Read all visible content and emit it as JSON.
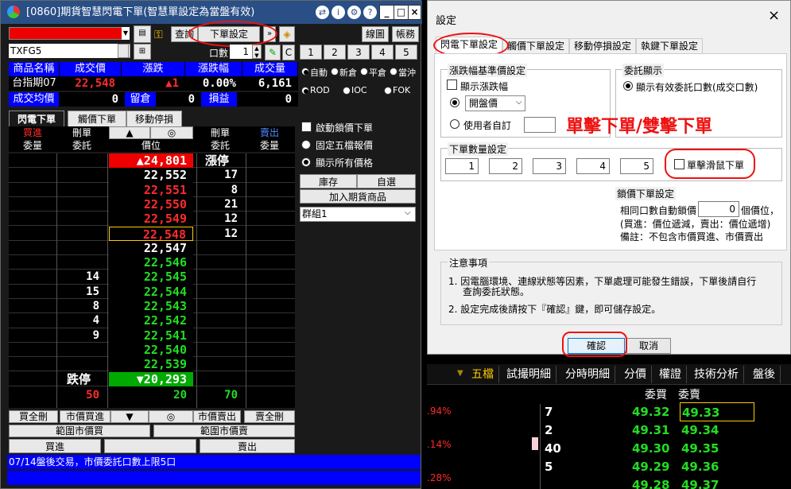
{
  "left": {
    "title": "[0860]期貨智慧閃電下單(智慧單設定為當盤有效)",
    "top_buttons": {
      "query": "查詢",
      "order_settings": "下單設定",
      "line_chart": "線圖",
      "account": "帳務"
    },
    "symbol": "TXFG5",
    "qty_label": "口數",
    "qty_value": "1",
    "c_btn": "C",
    "qty_presets": [
      "1",
      "2",
      "3",
      "4",
      "5"
    ],
    "info_headers": [
      "商品名稱",
      "成交價",
      "漲跌",
      "漲跌幅",
      "成交量"
    ],
    "info_values": {
      "name": "台指期07",
      "price": "22,548",
      "change": "▲1",
      "pct": "0.00%",
      "volume": "6,161"
    },
    "avg_label": "成交均價",
    "avg_value": "0",
    "remain_label": "留倉",
    "remain_value": "0",
    "pl_label": "損益",
    "pl_value": "0",
    "options_row1": [
      "自動",
      "新倉",
      "平倉",
      "當沖"
    ],
    "options_row2": [
      "ROD",
      "IOC",
      "FOK"
    ],
    "tabs": [
      "閃電下單",
      "觸價下單",
      "移動停損"
    ],
    "ladder_headers": {
      "buy_cancel": "刪單",
      "buy_order": "委託",
      "buy_entrust": "買進",
      "buy_qty": "委量",
      "price": "價位",
      "sell_cancel": "刪單",
      "sell_order": "委託",
      "sell_entrust": "賣出",
      "sell_qty": "委量",
      "up_arrow": "▲",
      "center": "◎"
    },
    "ladder": [
      {
        "price": "▲24,801",
        "type": "limitup",
        "sell": "漲停"
      },
      {
        "price": "22,552",
        "type": "white",
        "sell": "17"
      },
      {
        "price": "22,551",
        "type": "red",
        "sell": "8"
      },
      {
        "price": "22,550",
        "type": "red",
        "sell": "21"
      },
      {
        "price": "22,549",
        "type": "red",
        "sell": "12"
      },
      {
        "price": "22,548",
        "type": "current",
        "sell": "12"
      },
      {
        "price": "22,547",
        "type": "white",
        "buy": ""
      },
      {
        "price": "22,546",
        "type": "green",
        "buy": ""
      },
      {
        "price": "22,545",
        "type": "green",
        "buy": "14"
      },
      {
        "price": "22,544",
        "type": "green",
        "buy": "15"
      },
      {
        "price": "22,543",
        "type": "green",
        "buy": "8"
      },
      {
        "price": "22,542",
        "type": "green",
        "buy": "4"
      },
      {
        "price": "22,541",
        "type": "green",
        "buy": "9"
      },
      {
        "price": "22,540",
        "type": "green",
        "buy": ""
      },
      {
        "price": "22,539",
        "type": "green",
        "buy": ""
      },
      {
        "price": "▼20,293",
        "type": "limitdown",
        "buy": "跌停"
      }
    ],
    "totals": {
      "buy": "50",
      "mid": "20",
      "sell": "70"
    },
    "right_panel": {
      "enable_lock": "啟動鎖價下單",
      "fixed_five": "固定五檔報價",
      "show_all": "顯示所有價格",
      "stock_btn": "庫存",
      "select_btn": "自選",
      "add_btn": "加入期貨商品",
      "group": "群組1"
    },
    "bottom_buttons": [
      "買全刪",
      "市價買進",
      "▼",
      "◎",
      "市價賣出",
      "賣全刪"
    ],
    "range_buy": "範圍市價買",
    "range_sell": "範圍市價賣",
    "buy": "買進",
    "sell": "賣出",
    "status": "07/14盤後交易，市價委託口數上限5口"
  },
  "dialog": {
    "title": "設定",
    "close": "×",
    "tabs": [
      "閃電下單設定",
      "觸價下單設定",
      "移動停損設定",
      "執鍵下單設定"
    ],
    "base_group": "漲跌幅基準價設定",
    "show_change": "顯示漲跌幅",
    "open_price": "開盤價",
    "user_defined": "使用者自訂",
    "entrust_group": "委託顯示",
    "show_valid": "顯示有效委託口數(成交口數)",
    "annotation": "單擊下單/雙擊下單",
    "qty_group": "下單數量設定",
    "qty_values": [
      "1",
      "2",
      "3",
      "4",
      "5"
    ],
    "single_click": "單擊滑鼠下單",
    "lock_group": "鎖價下單設定",
    "lock_line1a": "相同口數自動鎖價",
    "lock_value": "0",
    "lock_line1b": "個價位，",
    "lock_line2": "(買進：價位遞減，賣出：價位遞增)",
    "lock_line3": "備註：不包含市價買進、市價賣出",
    "notes_title": "注意事項",
    "note1a": "1. 因電腦環境、連線狀態等因素，下單處理可能發生錯誤，下單後請自行",
    "note1b": "查詢委託狀態。",
    "note2": "2. 設定完成後請按下『確認』鍵，即可儲存設定。",
    "ok": "確認",
    "cancel": "取消"
  },
  "quote": {
    "tabs": [
      "五檔",
      "試撮明細",
      "分時明細",
      "分價",
      "權證",
      "技術分析",
      "盤後"
    ],
    "head_buy": "委買",
    "head_sell": "委賣",
    "pcts": [
      ".94%",
      ".14%",
      ".28%"
    ],
    "rows": [
      {
        "qty": "7",
        "bid": "49.32",
        "ask": "49.33"
      },
      {
        "qty": "2",
        "bid": "49.31",
        "ask": "49.34"
      },
      {
        "qty": "40",
        "bid": "49.30",
        "ask": "49.35"
      },
      {
        "qty": "5",
        "bid": "49.29",
        "ask": "49.36"
      },
      {
        "qty": "",
        "bid": "49.28",
        "ask": "49.37"
      }
    ]
  },
  "colors": {
    "blue_header": "#0000ff",
    "title_bar": "#2a4f86",
    "red": "#ff2b2b",
    "green": "#22dd22",
    "annotation": "#e11111"
  }
}
